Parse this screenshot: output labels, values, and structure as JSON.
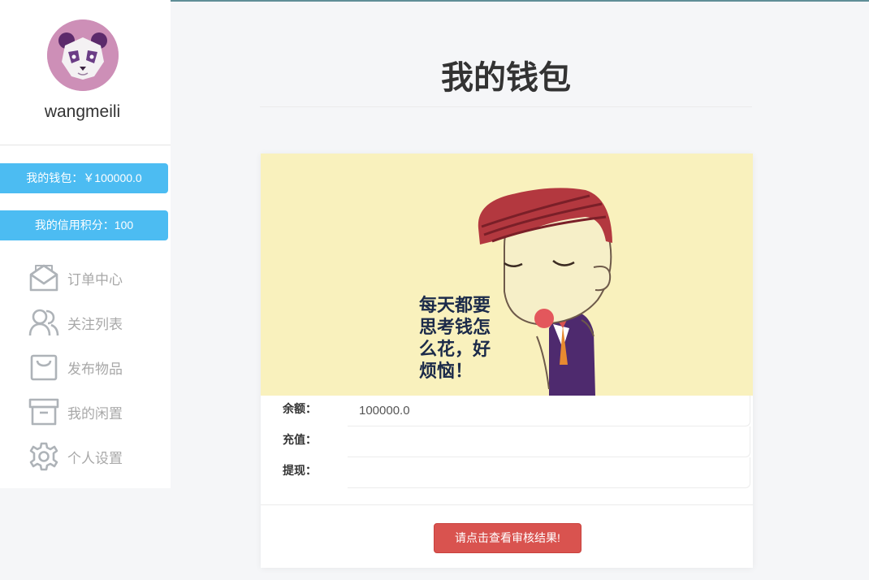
{
  "user": {
    "username": "wangmeili",
    "avatar_icon": "panda-avatar"
  },
  "sidebar": {
    "wallet_pill": "我的钱包：￥100000.0",
    "credit_pill": "我的信用积分：100",
    "items": [
      {
        "label": "订单中心",
        "icon": "envelope-icon"
      },
      {
        "label": "关注列表",
        "icon": "users-icon"
      },
      {
        "label": "发布物品",
        "icon": "shopping-bag-icon"
      },
      {
        "label": "我的闲置",
        "icon": "archive-box-icon"
      },
      {
        "label": "个人设置",
        "icon": "gear-icon"
      }
    ]
  },
  "main": {
    "title": "我的钱包",
    "banner": {
      "line1": "每天都要",
      "line2": "思考钱怎",
      "line3": "么花，好",
      "line4": "烦恼！"
    },
    "form": {
      "balance_label": "余额：",
      "balance_value": "100000.0",
      "recharge_label": "充值：",
      "recharge_value": "",
      "withdraw_label": "提现：",
      "withdraw_value": ""
    },
    "review_button": "请点击查看审核结果!"
  },
  "colors": {
    "accent": "#4cbcf2",
    "danger": "#d9534f",
    "banner_bg": "#f9f1bd"
  }
}
